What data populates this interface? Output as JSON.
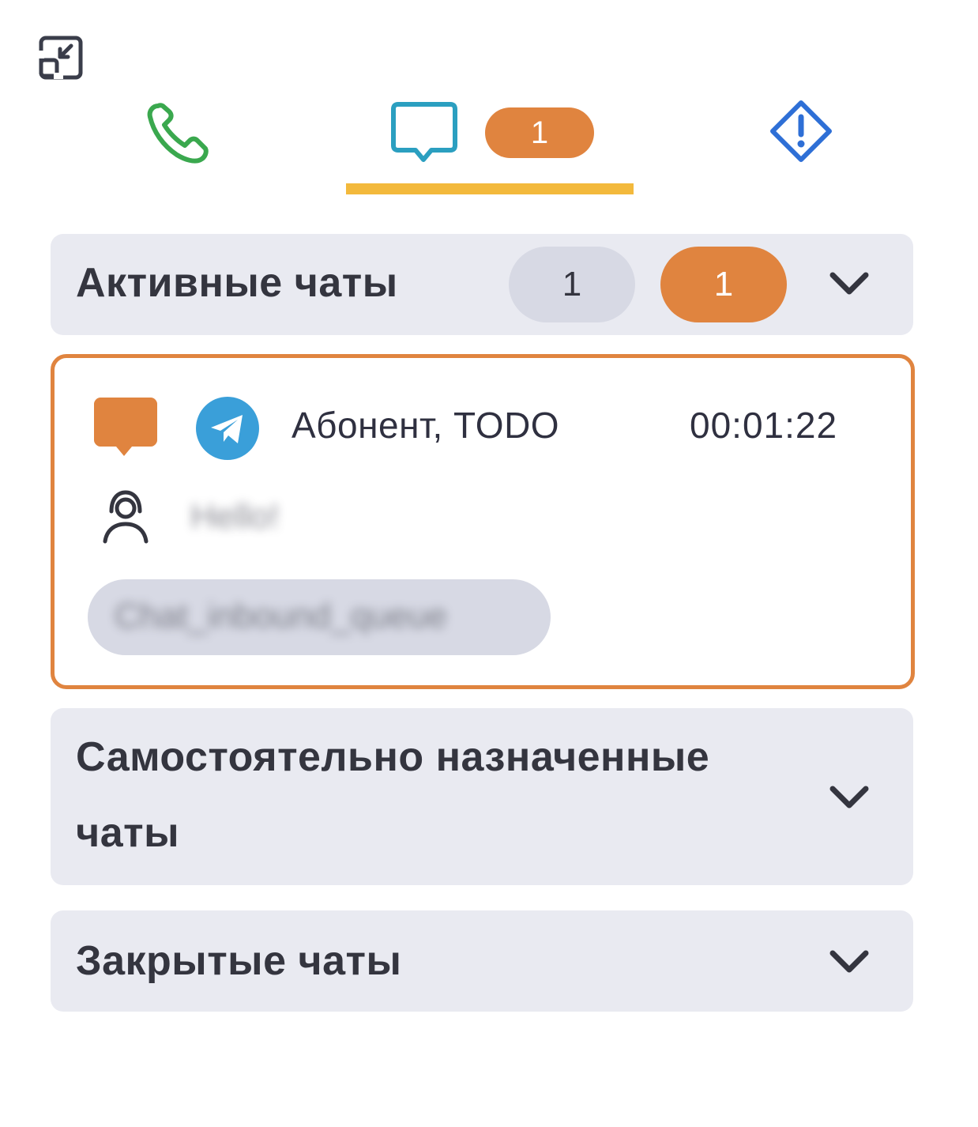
{
  "toolbar": {
    "collapse_icon": "collapse-icon"
  },
  "tabs": [
    {
      "id": "calls",
      "icon": "phone-icon",
      "color": "#3aa84e"
    },
    {
      "id": "chats",
      "icon": "chat-bubble-icon",
      "color": "#2b9fc0",
      "badge": "1",
      "active": true
    },
    {
      "id": "alerts",
      "icon": "alert-diamond-icon",
      "color": "#2e6fd6"
    }
  ],
  "colors": {
    "accent_orange": "#e0843f",
    "active_underline": "#f3b93c",
    "section_bg": "#e9eaf1",
    "pill_grey": "#d7d9e4"
  },
  "sections": {
    "active": {
      "title": "Активные чаты",
      "count_total": "1",
      "count_unread": "1",
      "expanded": true
    },
    "self_assigned": {
      "title": "Самостоятельно назначенные чаты",
      "expanded": false
    },
    "closed": {
      "title": "Закрытые чаты",
      "expanded": false
    }
  },
  "chats": [
    {
      "status_icon": "chat-status-icon",
      "channel_icon": "telegram-icon",
      "name": "Абонент, TODO",
      "timer": "00:01:22",
      "last_message": "Hello!",
      "queue": "Chat_inbound_queue"
    }
  ]
}
